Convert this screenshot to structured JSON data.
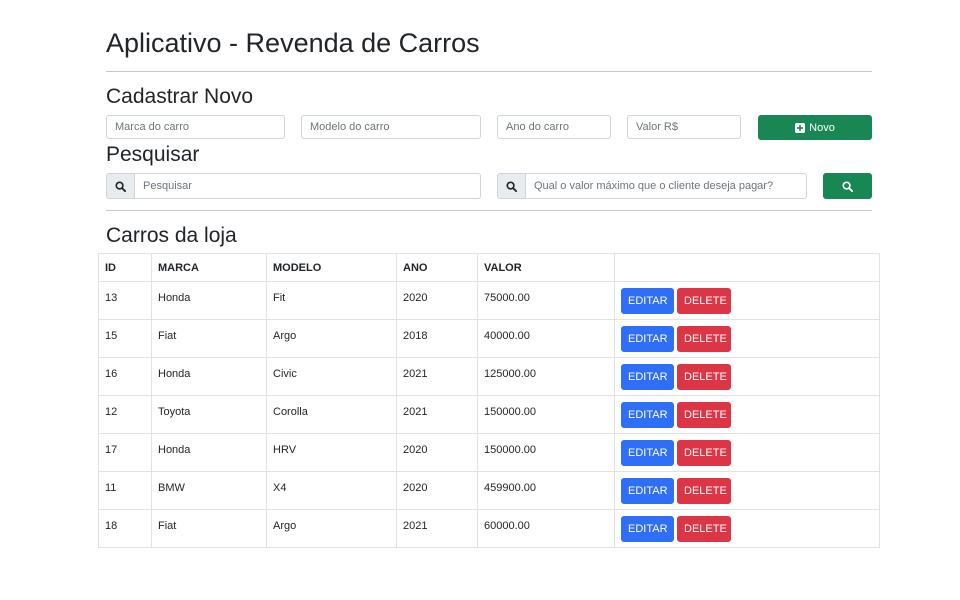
{
  "app_title": "Aplicativo - Revenda de Carros",
  "register": {
    "heading": "Cadastrar Novo",
    "brand_placeholder": "Marca do carro",
    "model_placeholder": "Modelo do carro",
    "year_placeholder": "Ano do carro",
    "price_placeholder": "Valor R$",
    "new_button": "Novo"
  },
  "search": {
    "heading": "Pesquisar",
    "query_placeholder": "Pesquisar",
    "max_price_placeholder": "Qual o valor máximo que o cliente deseja pagar?"
  },
  "table": {
    "heading": "Carros da loja",
    "columns": [
      "ID",
      "MARCA",
      "MODELO",
      "ANO",
      "VALOR",
      ""
    ],
    "edit_label": "EDITAR",
    "delete_label": "DELETE",
    "rows": [
      {
        "id": "13",
        "marca": "Honda",
        "modelo": "Fit",
        "ano": "2020",
        "valor": "75000.00"
      },
      {
        "id": "15",
        "marca": "Fiat",
        "modelo": "Argo",
        "ano": "2018",
        "valor": "40000.00"
      },
      {
        "id": "16",
        "marca": "Honda",
        "modelo": "Civic",
        "ano": "2021",
        "valor": "125000.00"
      },
      {
        "id": "12",
        "marca": "Toyota",
        "modelo": "Corolla",
        "ano": "2021",
        "valor": "150000.00"
      },
      {
        "id": "17",
        "marca": "Honda",
        "modelo": "HRV",
        "ano": "2020",
        "valor": "150000.00"
      },
      {
        "id": "11",
        "marca": "BMW",
        "modelo": "X4",
        "ano": "2020",
        "valor": "459900.00"
      },
      {
        "id": "18",
        "marca": "Fiat",
        "modelo": "Argo",
        "ano": "2021",
        "valor": "60000.00"
      }
    ]
  },
  "colors": {
    "success": "#198754",
    "primary": "#2f6ff7",
    "danger": "#dc3545"
  },
  "icons": {
    "new": "plus-square-icon",
    "search": "search-icon"
  }
}
